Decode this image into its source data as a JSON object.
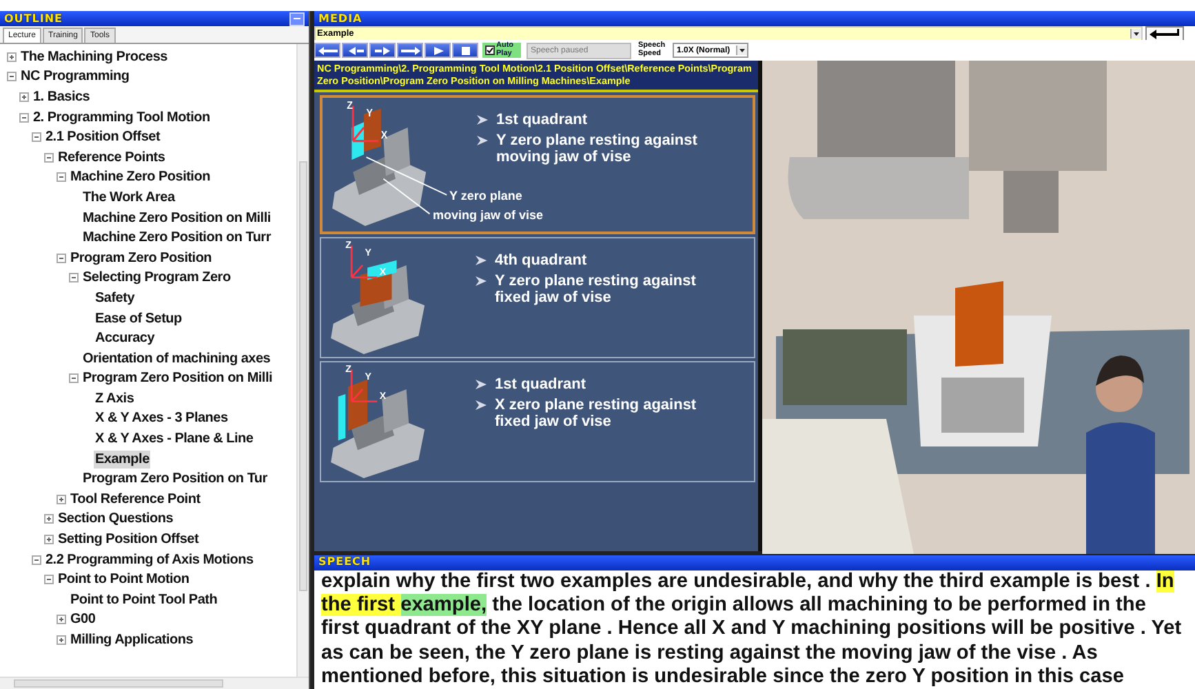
{
  "outline": {
    "title": "OUTLINE",
    "tabs": [
      {
        "label": "Lecture",
        "selected": true
      },
      {
        "label": "Training",
        "selected": false
      },
      {
        "label": "Tools",
        "selected": false
      }
    ],
    "tree": [
      {
        "label": "The Machining Process",
        "expanded": false,
        "selected": false
      },
      {
        "label": "NC Programming",
        "expanded": true,
        "selected": false,
        "children": [
          {
            "label": "1. Basics",
            "expanded": false,
            "selected": false
          },
          {
            "label": "2. Programming Tool Motion",
            "expanded": true,
            "selected": false,
            "children": [
              {
                "label": "2.1 Position Offset",
                "expanded": true,
                "selected": false,
                "children": [
                  {
                    "label": "Reference Points",
                    "expanded": true,
                    "selected": false,
                    "children": [
                      {
                        "label": "Machine Zero Position",
                        "expanded": true,
                        "selected": false,
                        "children": [
                          {
                            "label": "The Work Area",
                            "selected": false
                          },
                          {
                            "label": "Machine Zero Position on Milli",
                            "selected": false
                          },
                          {
                            "label": "Machine Zero Position on Turr",
                            "selected": false
                          }
                        ]
                      },
                      {
                        "label": "Program Zero Position",
                        "expanded": true,
                        "selected": false,
                        "children": [
                          {
                            "label": "Selecting Program Zero",
                            "expanded": true,
                            "selected": false,
                            "children": [
                              {
                                "label": "Safety",
                                "selected": false
                              },
                              {
                                "label": "Ease of Setup",
                                "selected": false
                              },
                              {
                                "label": "Accuracy",
                                "selected": false
                              }
                            ]
                          },
                          {
                            "label": "Orientation of machining axes",
                            "selected": false
                          },
                          {
                            "label": "Program Zero Position on Milli",
                            "expanded": true,
                            "selected": false,
                            "children": [
                              {
                                "label": "Z Axis",
                                "selected": false
                              },
                              {
                                "label": "X & Y Axes - 3 Planes",
                                "selected": false
                              },
                              {
                                "label": "X & Y Axes - Plane & Line",
                                "selected": false
                              },
                              {
                                "label": "Example",
                                "selected": true
                              }
                            ]
                          },
                          {
                            "label": "Program Zero Position on Tur",
                            "selected": false
                          }
                        ]
                      },
                      {
                        "label": "Tool Reference Point",
                        "expanded": false,
                        "selected": false
                      }
                    ]
                  },
                  {
                    "label": "Section Questions",
                    "expanded": false,
                    "selected": false
                  },
                  {
                    "label": "Setting Position Offset",
                    "expanded": false,
                    "selected": false
                  }
                ]
              },
              {
                "label": "2.2 Programming of Axis Motions",
                "expanded": true,
                "selected": false,
                "children": [
                  {
                    "label": "Point to Point Motion",
                    "expanded": true,
                    "selected": false,
                    "children": [
                      {
                        "label": "Point to Point Tool Path",
                        "selected": false
                      },
                      {
                        "label": "G00",
                        "expanded": false,
                        "selected": false
                      },
                      {
                        "label": "Milling Applications",
                        "expanded": false,
                        "selected": false
                      }
                    ]
                  }
                ]
              }
            ]
          }
        ]
      }
    ]
  },
  "media": {
    "title": "MEDIA",
    "topic": "Example",
    "auto_play": {
      "label": "Auto Play",
      "checked": true
    },
    "status": "Speech paused",
    "speed": {
      "label": "Speech Speed",
      "value": "1.0X (Normal)"
    },
    "breadcrumb": "NC Programming\\2. Programming Tool Motion\\2.1 Position Offset\\Reference Points\\Program Zero Position\\Program Zero Position on Milling Machines\\Example",
    "slides": [
      {
        "kind": "y-moving",
        "selected": true,
        "axes": [
          "Z",
          "Y",
          "X"
        ],
        "bullets": [
          "1st quadrant",
          "Y zero plane resting against moving jaw of vise"
        ],
        "callouts": [
          "Y zero plane",
          "moving jaw of vise"
        ]
      },
      {
        "kind": "y-fixed",
        "selected": false,
        "axes": [
          "Z",
          "Y",
          "X"
        ],
        "bullets": [
          "4th quadrant",
          "Y zero plane resting against fixed jaw of vise"
        ]
      },
      {
        "kind": "x-fixed",
        "selected": false,
        "axes": [
          "Z",
          "Y",
          "X"
        ],
        "bullets": [
          "1st quadrant",
          "X zero plane resting against fixed jaw of vise"
        ]
      }
    ]
  },
  "speech": {
    "title": "SPEECH",
    "segments": [
      {
        "text": "explain why the first two examples are undesirable, and why the third example is best . "
      },
      {
        "text": "In the first ",
        "color": "#ffff3c"
      },
      {
        "text": "example,",
        "color": "#8ee88e"
      },
      {
        "text": " the location of the origin allows all machining to be performed in the first quadrant of the XY plane . Hence all X and Y machining positions will be positive . Yet as can be seen, the Y zero plane is resting against the moving jaw of the vise . As mentioned before, this situation is undesirable since the zero Y position in this case"
      }
    ]
  }
}
